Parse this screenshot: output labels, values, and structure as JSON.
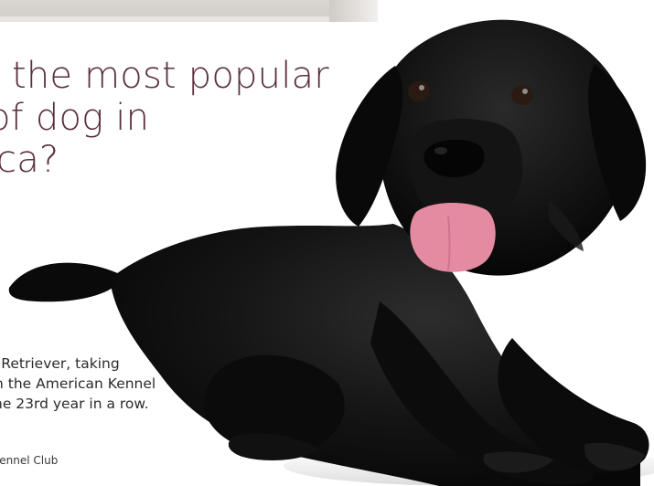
{
  "headline": {
    "line1": "s the most popular",
    "line2": "of dog in",
    "line3": "ca?"
  },
  "answer": {
    "line1": "r Retriever, taking",
    "line2": "n the American Kennel",
    "line3": "he 23rd year in a row."
  },
  "source": "Kennel Club",
  "colors": {
    "headline": "#5a2f3b",
    "background": "#ffffff"
  },
  "icons": {
    "photo": "black-labrador-puppy-photo",
    "top_photo": "cropped-top-photo"
  }
}
